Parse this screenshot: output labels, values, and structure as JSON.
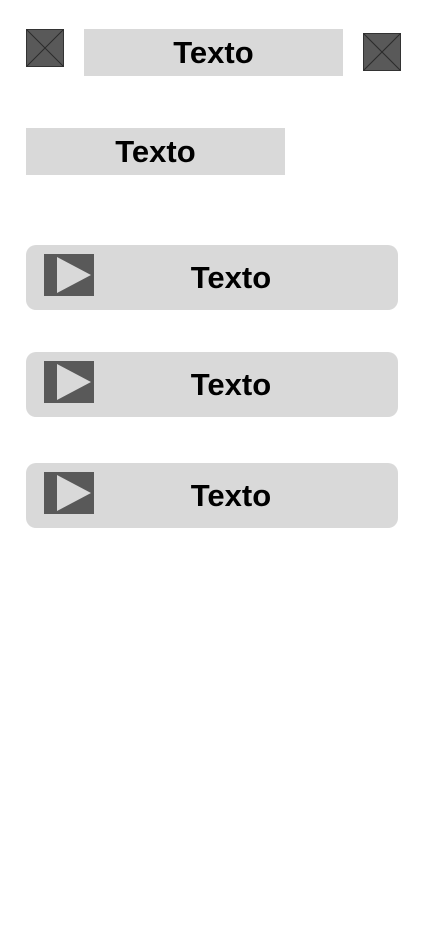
{
  "header": {
    "left_image": "image-placeholder-icon",
    "title": "Texto",
    "right_image": "image-placeholder-icon"
  },
  "section": {
    "label": "Texto"
  },
  "buttons": [
    {
      "icon": "play-icon",
      "label": "Texto"
    },
    {
      "icon": "play-icon",
      "label": "Texto"
    },
    {
      "icon": "play-icon",
      "label": "Texto"
    }
  ],
  "colors": {
    "box_fill": "#d9d9d9",
    "icon_fill": "#595959",
    "text": "#000000",
    "background": "#ffffff"
  }
}
